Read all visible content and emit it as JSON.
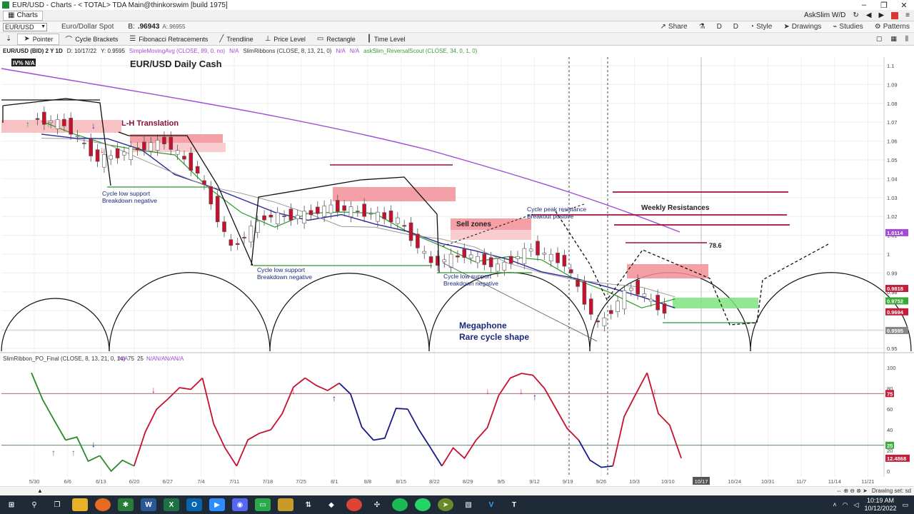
{
  "window": {
    "title": "EUR/USD - Charts - < TOTAL> TDA Main@thinkorswim [build 1975]",
    "tab_label": "Charts",
    "brand": "AskSlim W/D"
  },
  "symbol_row": {
    "symbol": "EUR/USD",
    "description": "Euro/Dollar Spot",
    "bid_label": "B:",
    "bid_value": ".96943",
    "ask_value": "A:.96955",
    "buttons": [
      "Share",
      "D",
      "D",
      "Style",
      "Drawings",
      "Studies",
      "Patterns"
    ]
  },
  "toolbar": {
    "tools": [
      "Pointer",
      "Cycle Brackets",
      "Fibonacci Retracements",
      "Trendline",
      "Price Level",
      "Rectangle",
      "Time Level"
    ]
  },
  "chart_header": {
    "symbol": "EUR/USD (BID) 2 Y 1D",
    "date_readout": "D: 10/17/22",
    "y_readout": "Y: 0.9595",
    "sma": "SimpleMovingAvg (CLOSE, 89, 0, no)",
    "na1": "N/A",
    "slim": "SlimRibbons (CLOSE, 8, 13, 21, 0)",
    "na2": "N/A",
    "na3": "N/A",
    "reversal": "askSlim_ReversalScout (CLOSE, 34, 0, 1, 0)",
    "iv_badge": "IV% N/A"
  },
  "annotations": {
    "title": "EUR/USD Daily Cash",
    "lh_translation": "L-H Translation",
    "cycle_low_1a": "Cycle low support",
    "cycle_low_1b": "Breakdown negative",
    "cycle_low_2a": "Cycle low support",
    "cycle_low_2b": "Breakdown negative",
    "cycle_low_3a": "Cycle low support",
    "cycle_low_3b": "Breakdown negative",
    "sell_zones": "Sell zones",
    "cycle_peak_a": "Cycle peak resistance",
    "cycle_peak_b": "Breakout positive",
    "weekly_res": "Weekly Resistances",
    "fib": "78.6",
    "megaphone_a": "Megaphone",
    "megaphone_b": "Rare cycle shape"
  },
  "price_axis": {
    "ticks": [
      "1.1",
      "1.09",
      "1.08",
      "1.07",
      "1.06",
      "1.05",
      "1.04",
      "1.03",
      "1.02",
      "1.01",
      "1",
      "0.99",
      "0.98",
      "0.97",
      "0.96",
      "0.95"
    ],
    "badges": [
      {
        "value": "1.0114",
        "color": "#a14bd6"
      },
      {
        "value": "0.9818",
        "color": "#c0203a"
      },
      {
        "value": "0.9752",
        "color": "#3aa83a"
      },
      {
        "value": "0.9694",
        "color": "#c0203a"
      },
      {
        "value": "0.9595",
        "color": "#888888"
      }
    ]
  },
  "oscillator": {
    "header": "SlimRibbon_PO_Final (CLOSE, 8, 13, 21, 0, 14)",
    "header_vals": [
      "N/A",
      "75",
      "25",
      "N/A",
      "N/A",
      "N/A",
      "N/A"
    ],
    "ticks": [
      "100",
      "80",
      "60",
      "40",
      "20",
      "0"
    ],
    "badges": [
      {
        "value": "75",
        "color": "#c0203a"
      },
      {
        "value": "25",
        "color": "#3aa83a"
      },
      {
        "value": "12.4868",
        "color": "#c0203a"
      }
    ]
  },
  "date_axis": {
    "labels": [
      "5/30",
      "6/6",
      "6/13",
      "6/20",
      "6/27",
      "7/4",
      "7/11",
      "7/18",
      "7/25",
      "8/1",
      "8/8",
      "8/15",
      "8/22",
      "8/29",
      "9/5",
      "9/12",
      "9/19",
      "9/26",
      "10/3",
      "10/10",
      "10/17",
      "10/24",
      "10/31",
      "11/7",
      "11/14",
      "11/21"
    ],
    "cursor_label": "10/17"
  },
  "status": {
    "drawing_set": "Drawing set: sd"
  },
  "taskbar": {
    "time": "10:19 AM",
    "date": "10/12/2022"
  },
  "chart_data": {
    "type": "candlestick",
    "title": "EUR/USD Daily Cash",
    "x": [
      "5/30",
      "6/6",
      "6/13",
      "6/20",
      "6/27",
      "7/4",
      "7/11",
      "7/18",
      "7/25",
      "8/1",
      "8/8",
      "8/15",
      "8/22",
      "8/29",
      "9/5",
      "9/12",
      "9/19",
      "9/26",
      "10/3",
      "10/10"
    ],
    "close": [
      1.072,
      1.069,
      1.05,
      1.055,
      1.06,
      1.043,
      1.003,
      1.02,
      1.02,
      1.025,
      1.022,
      1.018,
      0.995,
      1.0,
      0.993,
      1.003,
      0.995,
      0.962,
      0.983,
      0.9694
    ],
    "ylim": [
      0.95,
      1.1
    ],
    "oscillator": {
      "name": "SlimRibbon_PO_Final",
      "values": [
        95,
        30,
        15,
        5,
        70,
        90,
        5,
        40,
        90,
        85,
        30,
        60,
        5,
        30,
        90,
        80,
        30,
        5,
        95,
        12.49
      ],
      "ylim": [
        0,
        100
      ],
      "levels": [
        75,
        25
      ]
    }
  }
}
